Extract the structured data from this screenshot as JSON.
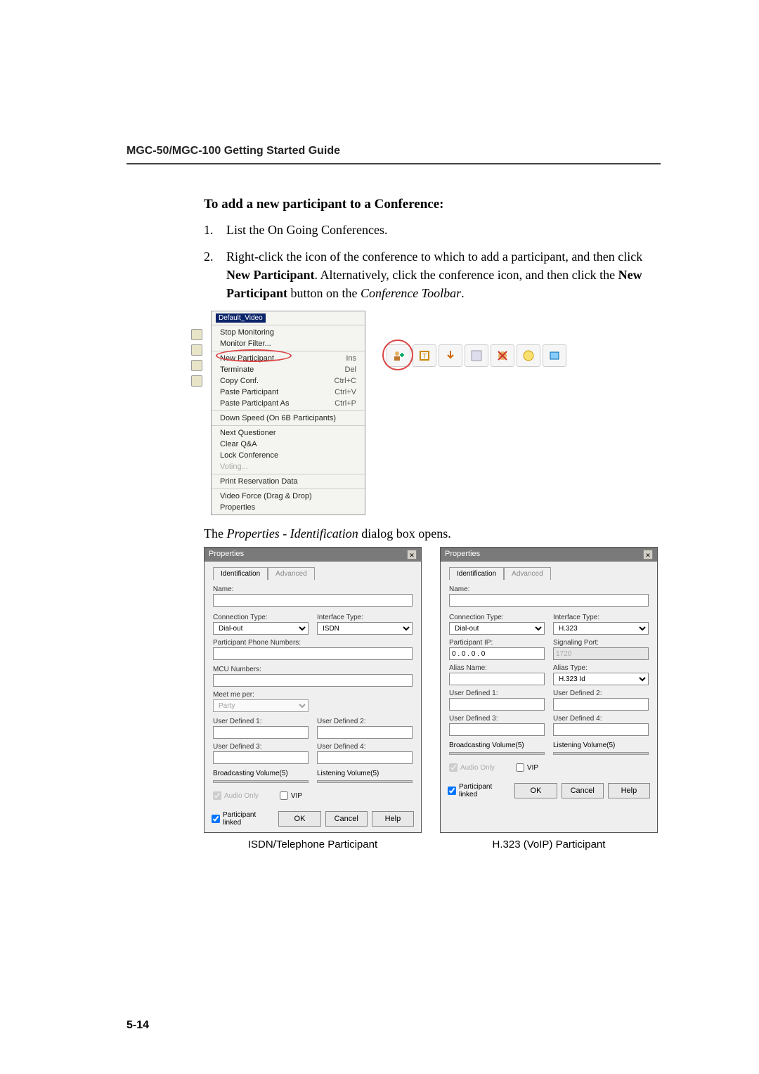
{
  "header": {
    "guide_title": "MGC-50/MGC-100 Getting Started Guide"
  },
  "section": {
    "heading": "To add a new participant to a Conference:",
    "step1_text": "List the On Going Conferences.",
    "step2_pre": "Right-click the icon of the conference to which to add a participant, and then click ",
    "step2_bold1": "New Participant",
    "step2_mid": ". Alternatively, click the conference icon, and then click the ",
    "step2_bold2": "New Participant",
    "step2_post1": " button on the ",
    "step2_italic": "Conference Toolbar",
    "step2_post2": "."
  },
  "context_menu": {
    "node_label": "Default_Video",
    "items": [
      {
        "label": "Stop Monitoring",
        "short": ""
      },
      {
        "label": "Monitor Filter...",
        "short": ""
      }
    ],
    "group2": [
      {
        "label": "New Participant...",
        "short": "Ins"
      },
      {
        "label": "Terminate",
        "short": "Del"
      },
      {
        "label": "Copy Conf.",
        "short": "Ctrl+C"
      },
      {
        "label": "Paste Participant",
        "short": "Ctrl+V"
      },
      {
        "label": "Paste Participant As",
        "short": "Ctrl+P"
      }
    ],
    "group3": [
      {
        "label": "Down Speed (On 6B Participants)",
        "short": ""
      }
    ],
    "group4": [
      {
        "label": "Next Questioner",
        "short": ""
      },
      {
        "label": "Clear Q&A",
        "short": ""
      },
      {
        "label": "Lock Conference",
        "short": ""
      },
      {
        "label": "Voting...",
        "short": "",
        "disabled": true
      }
    ],
    "group5": [
      {
        "label": "Print Reservation Data",
        "short": ""
      }
    ],
    "group6": [
      {
        "label": "Video Force (Drag & Drop)",
        "short": ""
      },
      {
        "label": "Properties",
        "short": ""
      }
    ]
  },
  "opens_text_pre": "The ",
  "opens_text_italic": "Properties - Identification",
  "opens_text_post": " dialog box opens.",
  "dialog_shared": {
    "title": "Properties",
    "tab_identification": "Identification",
    "tab_advanced": "Advanced",
    "name_label": "Name:",
    "connection_type_label": "Connection Type:",
    "interface_type_label": "Interface Type:",
    "dial_out": "Dial-out",
    "ud1": "User Defined 1:",
    "ud2": "User Defined 2:",
    "ud3": "User Defined 3:",
    "ud4": "User Defined 4:",
    "broadcasting": "Broadcasting Volume(5)",
    "listening": "Listening Volume(5)",
    "audio_only": "Audio Only",
    "vip": "VIP",
    "participant_linked": "Participant linked",
    "ok": "OK",
    "cancel": "Cancel",
    "help": "Help"
  },
  "dialog_isdn": {
    "interface_value": "ISDN",
    "participant_phone": "Participant Phone Numbers:",
    "mcu_numbers": "MCU Numbers:",
    "meet_me_per": "Meet me per:",
    "party": "Party"
  },
  "dialog_h323": {
    "interface_value": "H.323",
    "participant_ip": "Participant IP:",
    "ip_value": "0 . 0 . 0 . 0",
    "signaling_port": "Signaling Port:",
    "signaling_value": "1720",
    "alias_name": "Alias Name:",
    "alias_type": "Alias Type:",
    "alias_type_value": "H.323 Id"
  },
  "captions": {
    "left": "ISDN/Telephone Participant",
    "right": "H.323 (VoIP) Participant"
  },
  "page_number": "5-14"
}
